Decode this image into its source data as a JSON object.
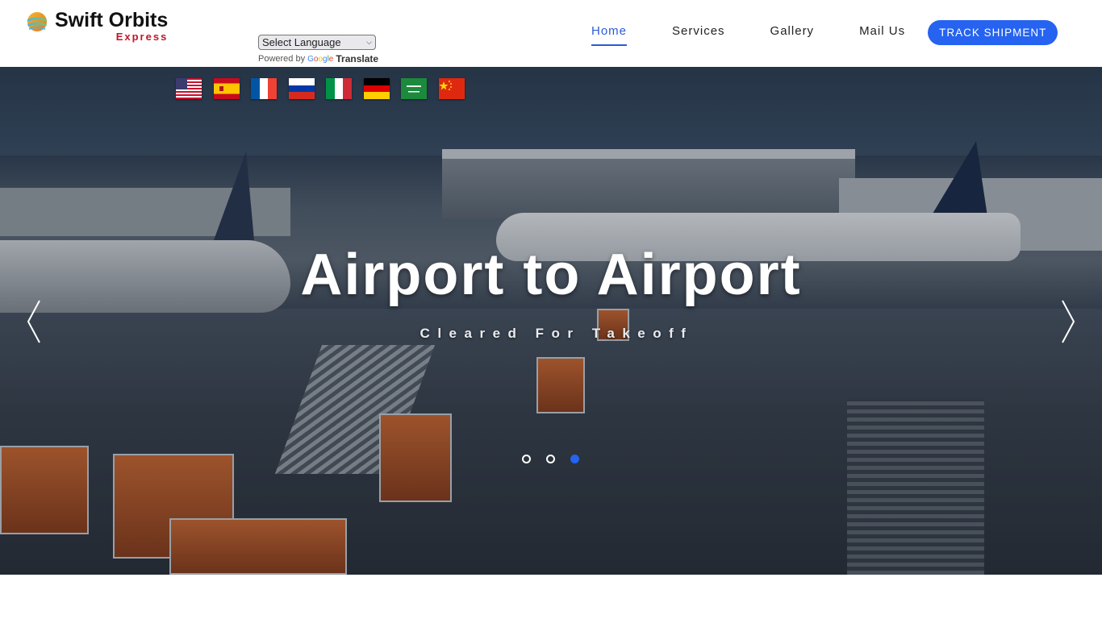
{
  "brand": {
    "name": "Swift Orbits",
    "tagline": "Express"
  },
  "translate": {
    "select_value": "Select Language",
    "powered_by": "Powered by",
    "google_letters": [
      "G",
      "o",
      "o",
      "g",
      "l",
      "e"
    ],
    "translate_label": "Translate"
  },
  "nav": {
    "items": [
      {
        "label": "Home",
        "active": true
      },
      {
        "label": "Services",
        "active": false
      },
      {
        "label": "Gallery",
        "active": false
      },
      {
        "label": "Mail Us",
        "active": false
      }
    ],
    "cta_label": "TRACK SHIPMENT",
    "accent_color": "#2563f0"
  },
  "flags": [
    {
      "language": "English",
      "country": "United States"
    },
    {
      "language": "Spanish",
      "country": "Spain"
    },
    {
      "language": "French",
      "country": "France"
    },
    {
      "language": "Russian",
      "country": "Russia"
    },
    {
      "language": "Italian",
      "country": "Italy"
    },
    {
      "language": "German",
      "country": "Germany"
    },
    {
      "language": "Arabic",
      "country": "Saudi Arabia"
    },
    {
      "language": "Chinese",
      "country": "China"
    }
  ],
  "hero": {
    "title": "Airport to Airport",
    "subtitle": "Cleared For Takeoff",
    "slides_total": 3,
    "active_slide": 3,
    "prev_icon": "chevron-left-icon",
    "next_icon": "chevron-right-icon"
  }
}
